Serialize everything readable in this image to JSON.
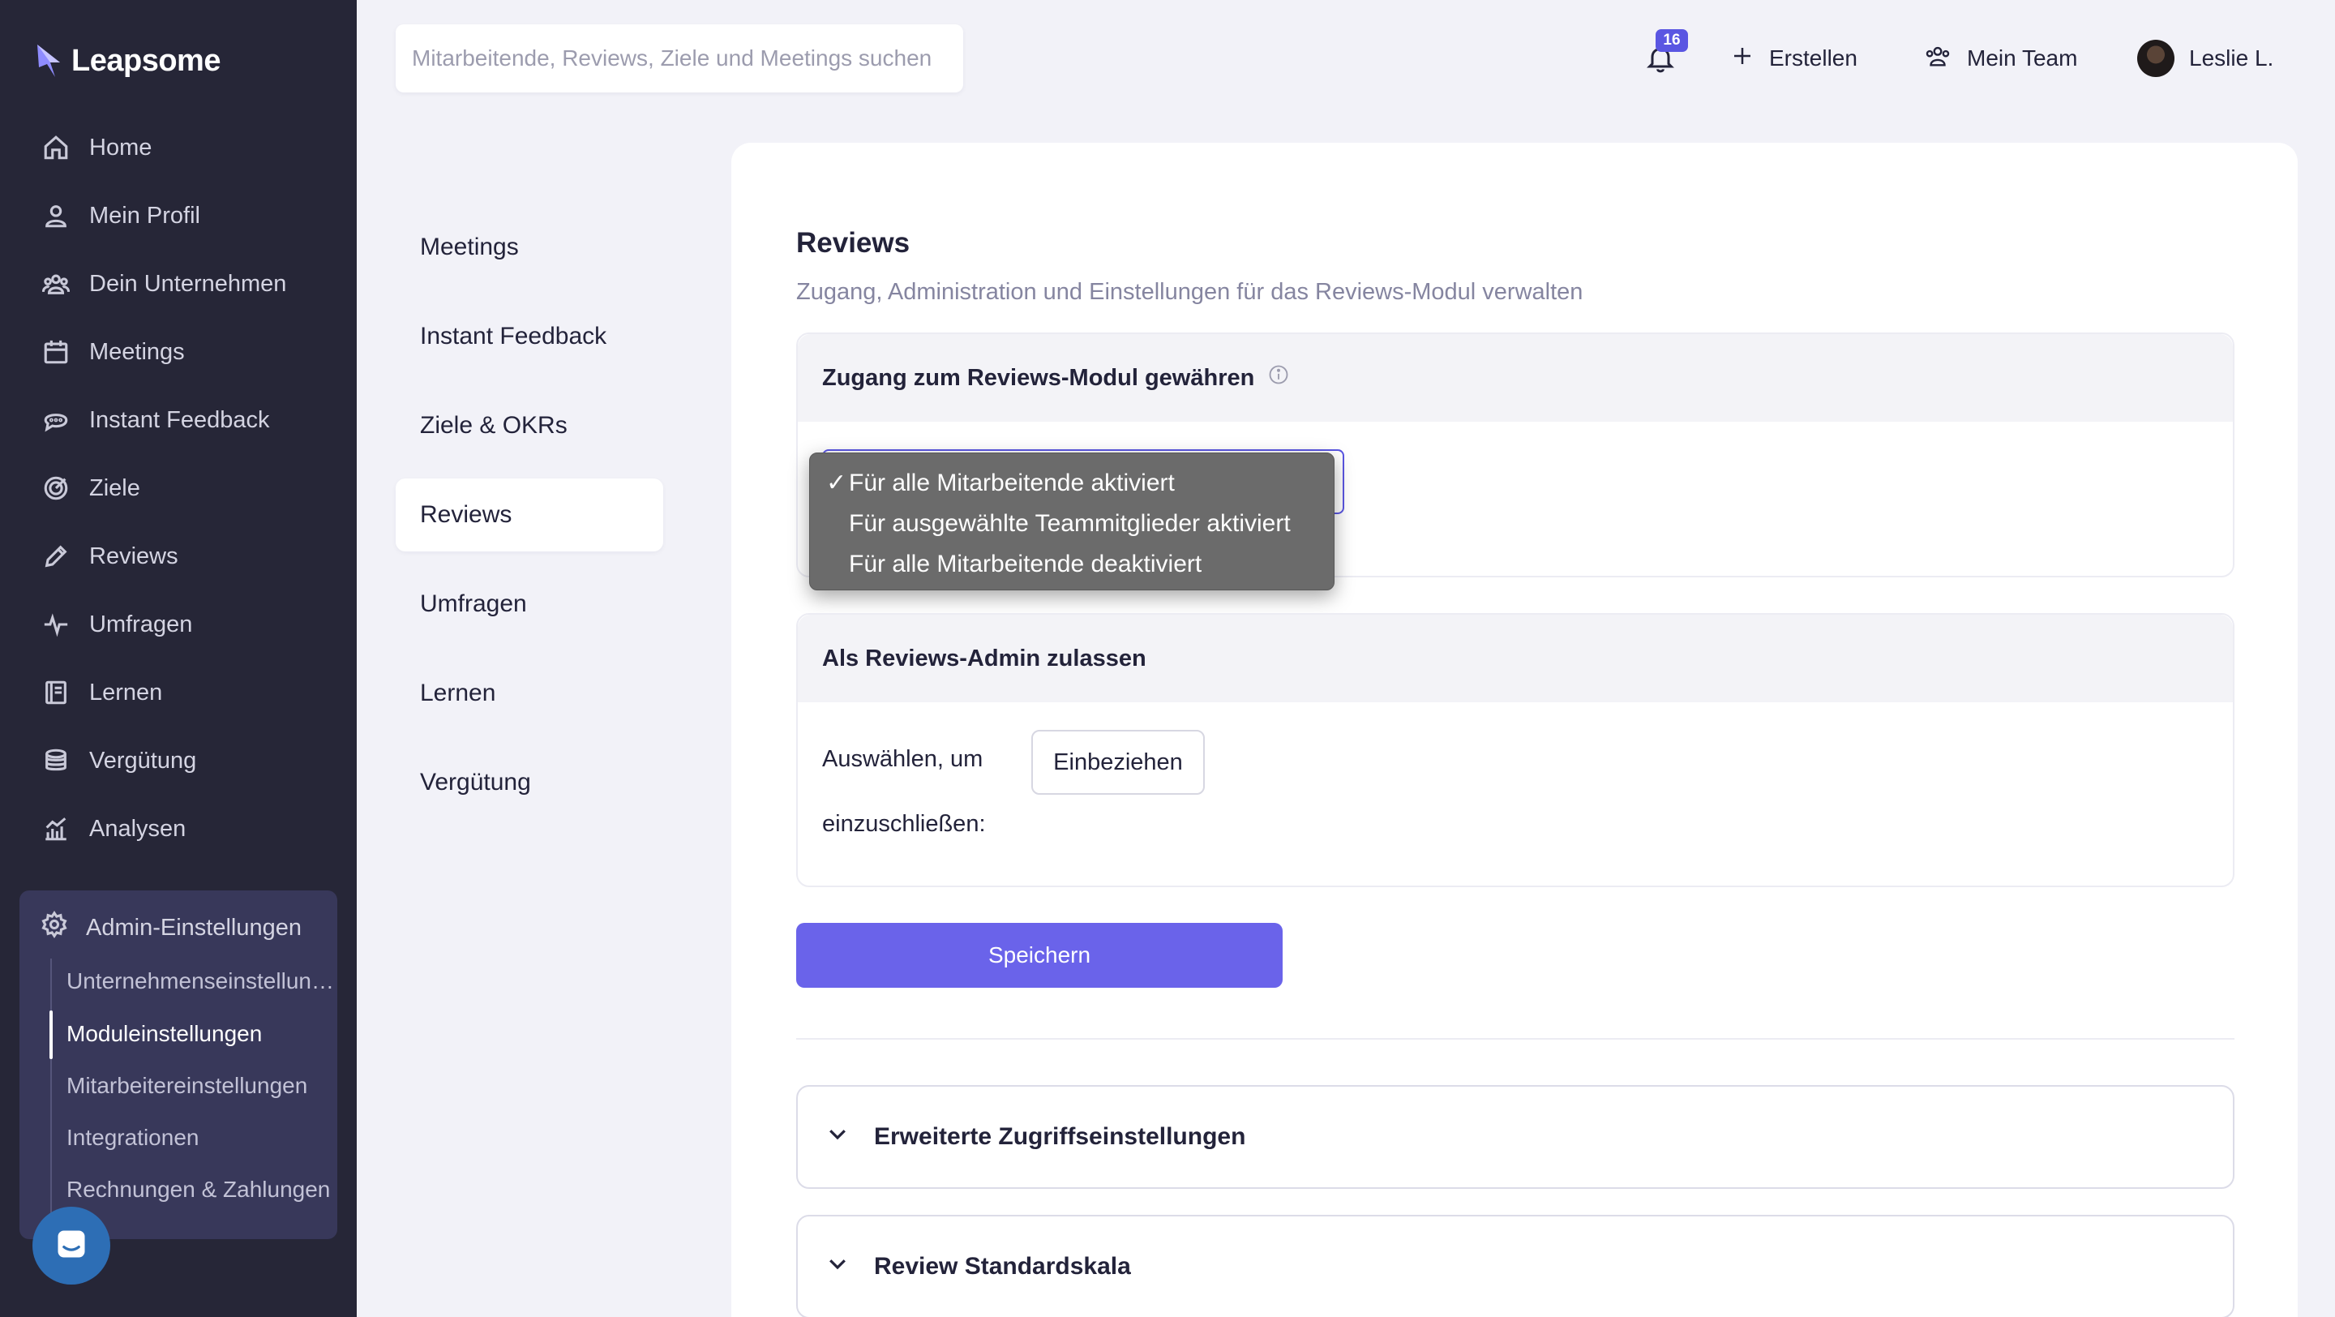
{
  "brand": {
    "name": "Leapsome",
    "accent": "#5a56e2",
    "sidebar_bg": "#262637"
  },
  "sidebar": {
    "items": [
      {
        "label": "Home",
        "icon": "home-icon"
      },
      {
        "label": "Mein Profil",
        "icon": "user-icon"
      },
      {
        "label": "Dein Unternehmen",
        "icon": "users-icon"
      },
      {
        "label": "Meetings",
        "icon": "calendar-icon"
      },
      {
        "label": "Instant Feedback",
        "icon": "chat-icon"
      },
      {
        "label": "Ziele",
        "icon": "target-icon"
      },
      {
        "label": "Reviews",
        "icon": "pencil-icon"
      },
      {
        "label": "Umfragen",
        "icon": "pulse-icon"
      },
      {
        "label": "Lernen",
        "icon": "book-icon"
      },
      {
        "label": "Vergütung",
        "icon": "coins-icon"
      },
      {
        "label": "Analysen",
        "icon": "chart-icon"
      }
    ],
    "admin": {
      "label": "Admin-Einstellungen",
      "icon": "gear-icon",
      "subitems": [
        {
          "label": "Unternehmenseinstellungen"
        },
        {
          "label": "Moduleinstellungen",
          "active": true
        },
        {
          "label": "Mitarbeitereinstellungen"
        },
        {
          "label": "Integrationen"
        },
        {
          "label": "Rechnungen & Zahlungen"
        }
      ]
    }
  },
  "topbar": {
    "search_placeholder": "Mitarbeitende, Reviews, Ziele und Meetings suchen",
    "notifications_count": "16",
    "create_label": "Erstellen",
    "team_label": "Mein Team",
    "user_name": "Leslie L."
  },
  "subnav": {
    "items": [
      {
        "label": "Meetings"
      },
      {
        "label": "Instant Feedback"
      },
      {
        "label": "Ziele & OKRs"
      },
      {
        "label": "Reviews",
        "active": true
      },
      {
        "label": "Umfragen"
      },
      {
        "label": "Lernen"
      },
      {
        "label": "Vergütung"
      }
    ]
  },
  "main": {
    "title": "Reviews",
    "subtitle": "Zugang, Administration und Einstellungen für das Reviews-Modul verwalten",
    "access_section": {
      "heading": "Zugang zum Reviews-Modul gewähren",
      "check_mark": "✓",
      "options": [
        "Für alle Mitarbeitende aktiviert",
        "Für ausgewählte Teammitglieder aktiviert",
        "Für alle Mitarbeitende deaktiviert"
      ],
      "selected_index": 0
    },
    "admin_section": {
      "heading": "Als Reviews-Admin zulassen",
      "label_line1": "Auswählen, um",
      "label_line2": "einzuschließen:",
      "include_button": "Einbeziehen"
    },
    "save_button": "Speichern",
    "accordions": [
      {
        "label": "Erweiterte Zugriffseinstellungen"
      },
      {
        "label": "Review Standardskala"
      }
    ]
  }
}
